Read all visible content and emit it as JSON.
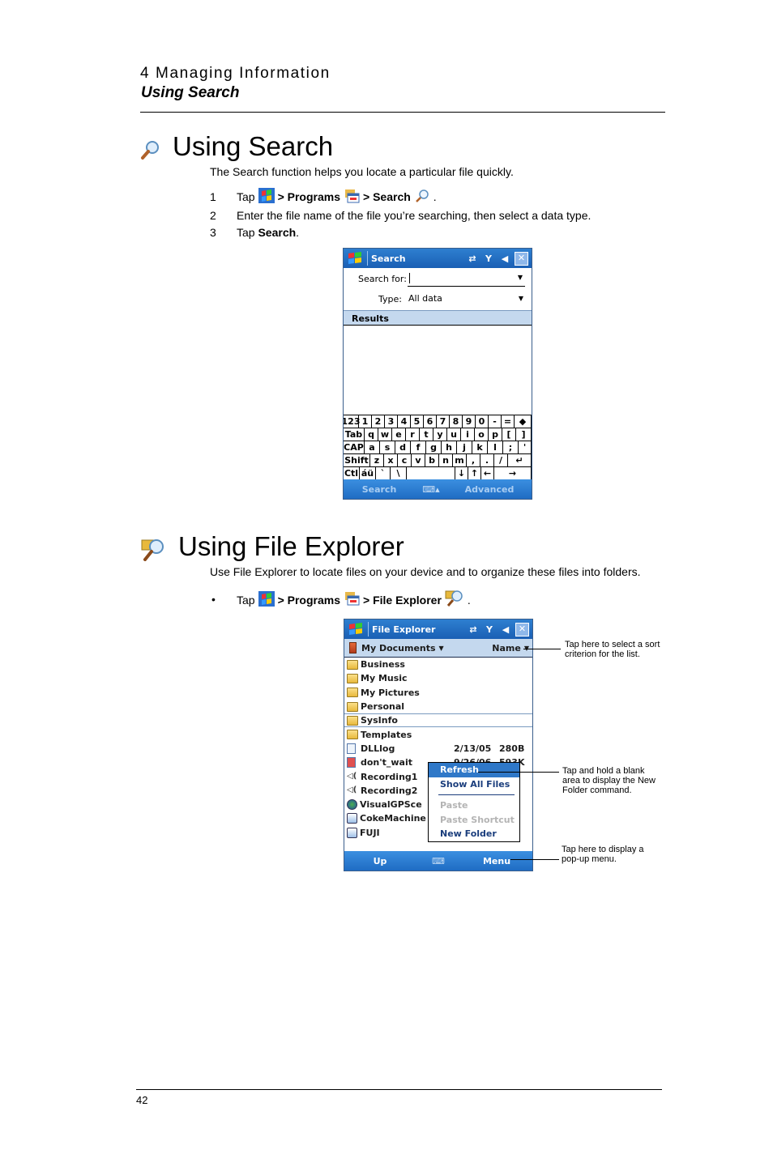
{
  "header": {
    "chapter": "4 Managing Information",
    "section": "Using Search"
  },
  "search_section": {
    "title": "Using Search",
    "intro": "The Search function helps you locate a particular file quickly.",
    "steps": [
      {
        "num": "1",
        "pre": "Tap",
        "parts": [
          "> Programs",
          "> Search"
        ],
        "end": "."
      },
      {
        "num": "2",
        "text": "Enter the file name of the file you’re searching, then select a data type."
      },
      {
        "num": "3",
        "pre": "Tap",
        "bold": "Search",
        "end": "."
      }
    ],
    "screen": {
      "title": "Search",
      "search_for_label": "Search for:",
      "search_for_value": "",
      "type_label": "Type:",
      "type_value": "All data",
      "results_label": "Results",
      "keyboard": [
        [
          "123",
          "1",
          "2",
          "3",
          "4",
          "5",
          "6",
          "7",
          "8",
          "9",
          "0",
          "-",
          "=",
          "◆"
        ],
        [
          "Tab",
          "q",
          "w",
          "e",
          "r",
          "t",
          "y",
          "u",
          "i",
          "o",
          "p",
          "[",
          "]"
        ],
        [
          "CAP",
          "a",
          "s",
          "d",
          "f",
          "g",
          "h",
          "j",
          "k",
          "l",
          ";",
          "'"
        ],
        [
          "Shift",
          "z",
          "x",
          "c",
          "v",
          "b",
          "n",
          "m",
          ",",
          ".",
          "/",
          "↵"
        ],
        [
          "Ctl",
          "áü",
          "`",
          "\\",
          "",
          "↓",
          "↑",
          "←",
          "→"
        ]
      ],
      "softkey_left": "Search",
      "softkey_right": "Advanced"
    }
  },
  "explorer_section": {
    "title": "Using File Explorer",
    "intro": "Use File Explorer to locate files on your device and to organize these files into folders.",
    "bullet": {
      "pre": "Tap",
      "parts": [
        "> Programs",
        "> File Explorer"
      ],
      "end": "."
    },
    "screen": {
      "title": "File Explorer",
      "location": "My Documents",
      "sort": "Name",
      "items": [
        {
          "name": "Business",
          "type": "folder"
        },
        {
          "name": "My Music",
          "type": "folder"
        },
        {
          "name": "My Pictures",
          "type": "folder"
        },
        {
          "name": "Personal",
          "type": "folder"
        },
        {
          "name": "SysInfo",
          "type": "folder"
        },
        {
          "name": "Templates",
          "type": "folder"
        },
        {
          "name": "DLLlog",
          "type": "file",
          "date": "2/13/05",
          "size": "280B"
        },
        {
          "name": "don't_wait",
          "type": "file",
          "date": "9/26/06",
          "size": "593K"
        },
        {
          "name": "Recording1",
          "type": "audio"
        },
        {
          "name": "Recording2",
          "type": "audio"
        },
        {
          "name": "VisualGPSce",
          "type": "app"
        },
        {
          "name": "CokeMachine",
          "type": "app"
        },
        {
          "name": "FUJI",
          "type": "app"
        }
      ],
      "context_menu": [
        "Refresh",
        "Show All Files",
        "Paste",
        "Paste Shortcut",
        "New Folder"
      ],
      "softkey_left": "Up",
      "softkey_right": "Menu"
    },
    "callouts": {
      "sort": "Tap here to select a sort criterion for the list.",
      "new_folder": "Tap and hold a blank area to display the New Folder command.",
      "menu": "Tap here to display a pop-up menu."
    }
  },
  "footer": {
    "page_number": "42"
  }
}
